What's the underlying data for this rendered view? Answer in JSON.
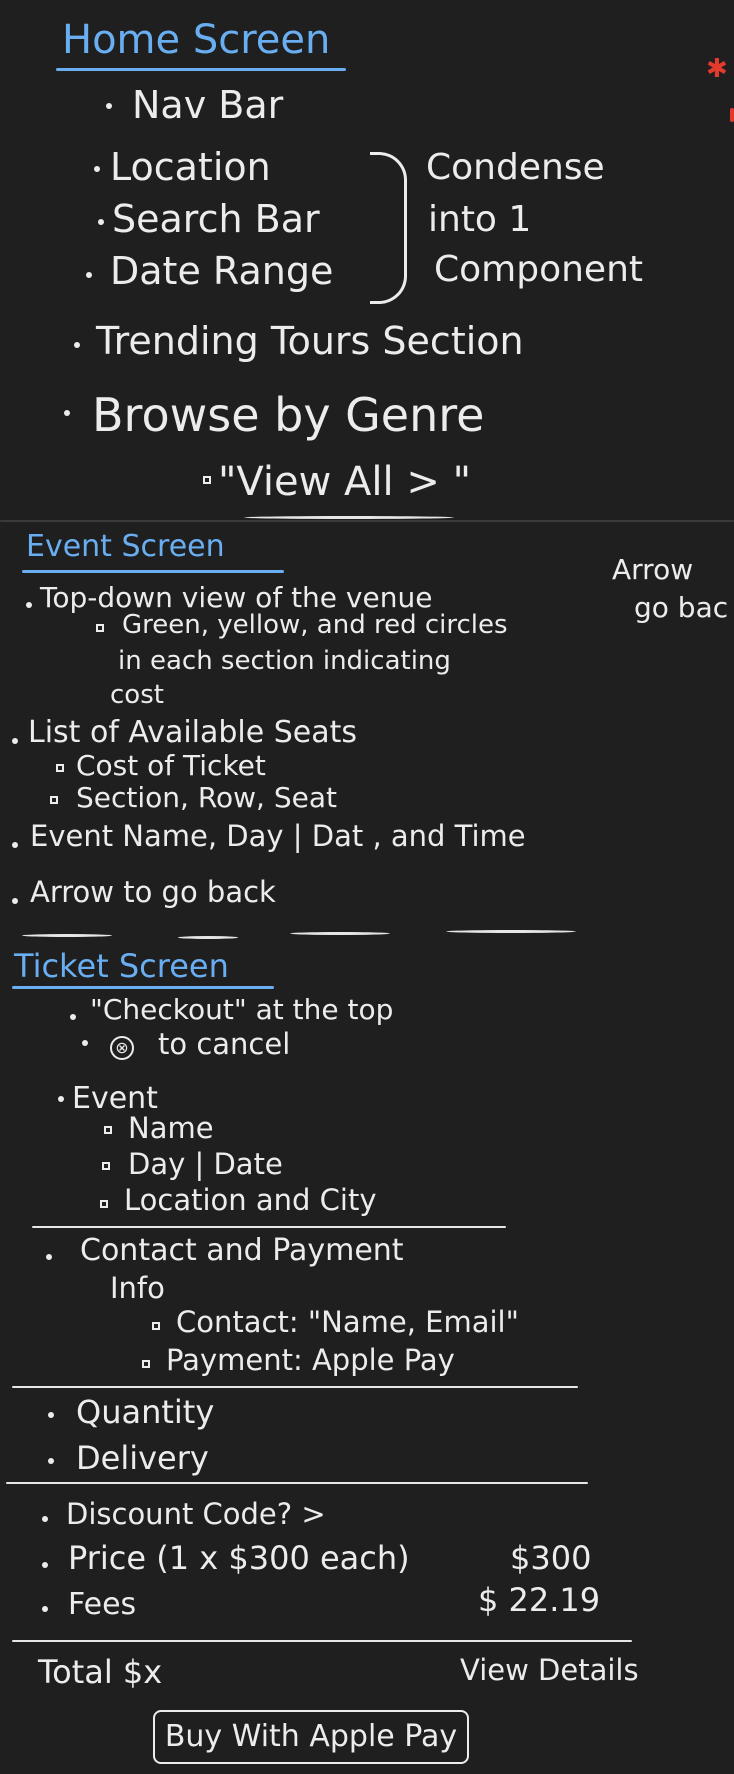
{
  "home": {
    "title": "Home Screen",
    "items": [
      "Nav Bar",
      "Location",
      "Search Bar",
      "Date Range",
      "Trending Tours Section",
      "Browse by Genre"
    ],
    "brace_note": [
      "Condense",
      "into 1",
      "Component"
    ],
    "view_all": "\"View All > \""
  },
  "event": {
    "title": "Event Screen",
    "side_note": [
      "Arrow",
      "go bac"
    ],
    "items": {
      "venue": "Top-down view of the venue",
      "circles": [
        "Green, yellow, and red circles",
        "in each section indicating",
        "cost"
      ],
      "seats": "List of Available Seats",
      "cost": "Cost of Ticket",
      "section": "Section, Row, Seat",
      "name": "Event Name, Day | Dat , and Time",
      "arrow": "Arrow to go back"
    }
  },
  "ticket": {
    "title": "Ticket Screen",
    "checkout": "\"Checkout\" at the top",
    "cancel_icon": "⊗",
    "cancel": "to cancel",
    "event": "Event",
    "event_details": [
      "Name",
      "Day | Date",
      "Location and City"
    ],
    "contact_title": [
      "Contact and Payment",
      "Info"
    ],
    "contact": "Contact: \"Name, Email\"",
    "payment": "Payment: Apple Pay",
    "quantity": "Quantity",
    "delivery": "Delivery",
    "discount": "Discount Code?  >",
    "price_label": "Price (1 x $300 each)",
    "price_value": "$300",
    "fees_label": "Fees",
    "fees_value": "$ 22.19",
    "total_label": "Total $x",
    "view_details": "View Details",
    "buy_button": "Buy With Apple Pay"
  }
}
